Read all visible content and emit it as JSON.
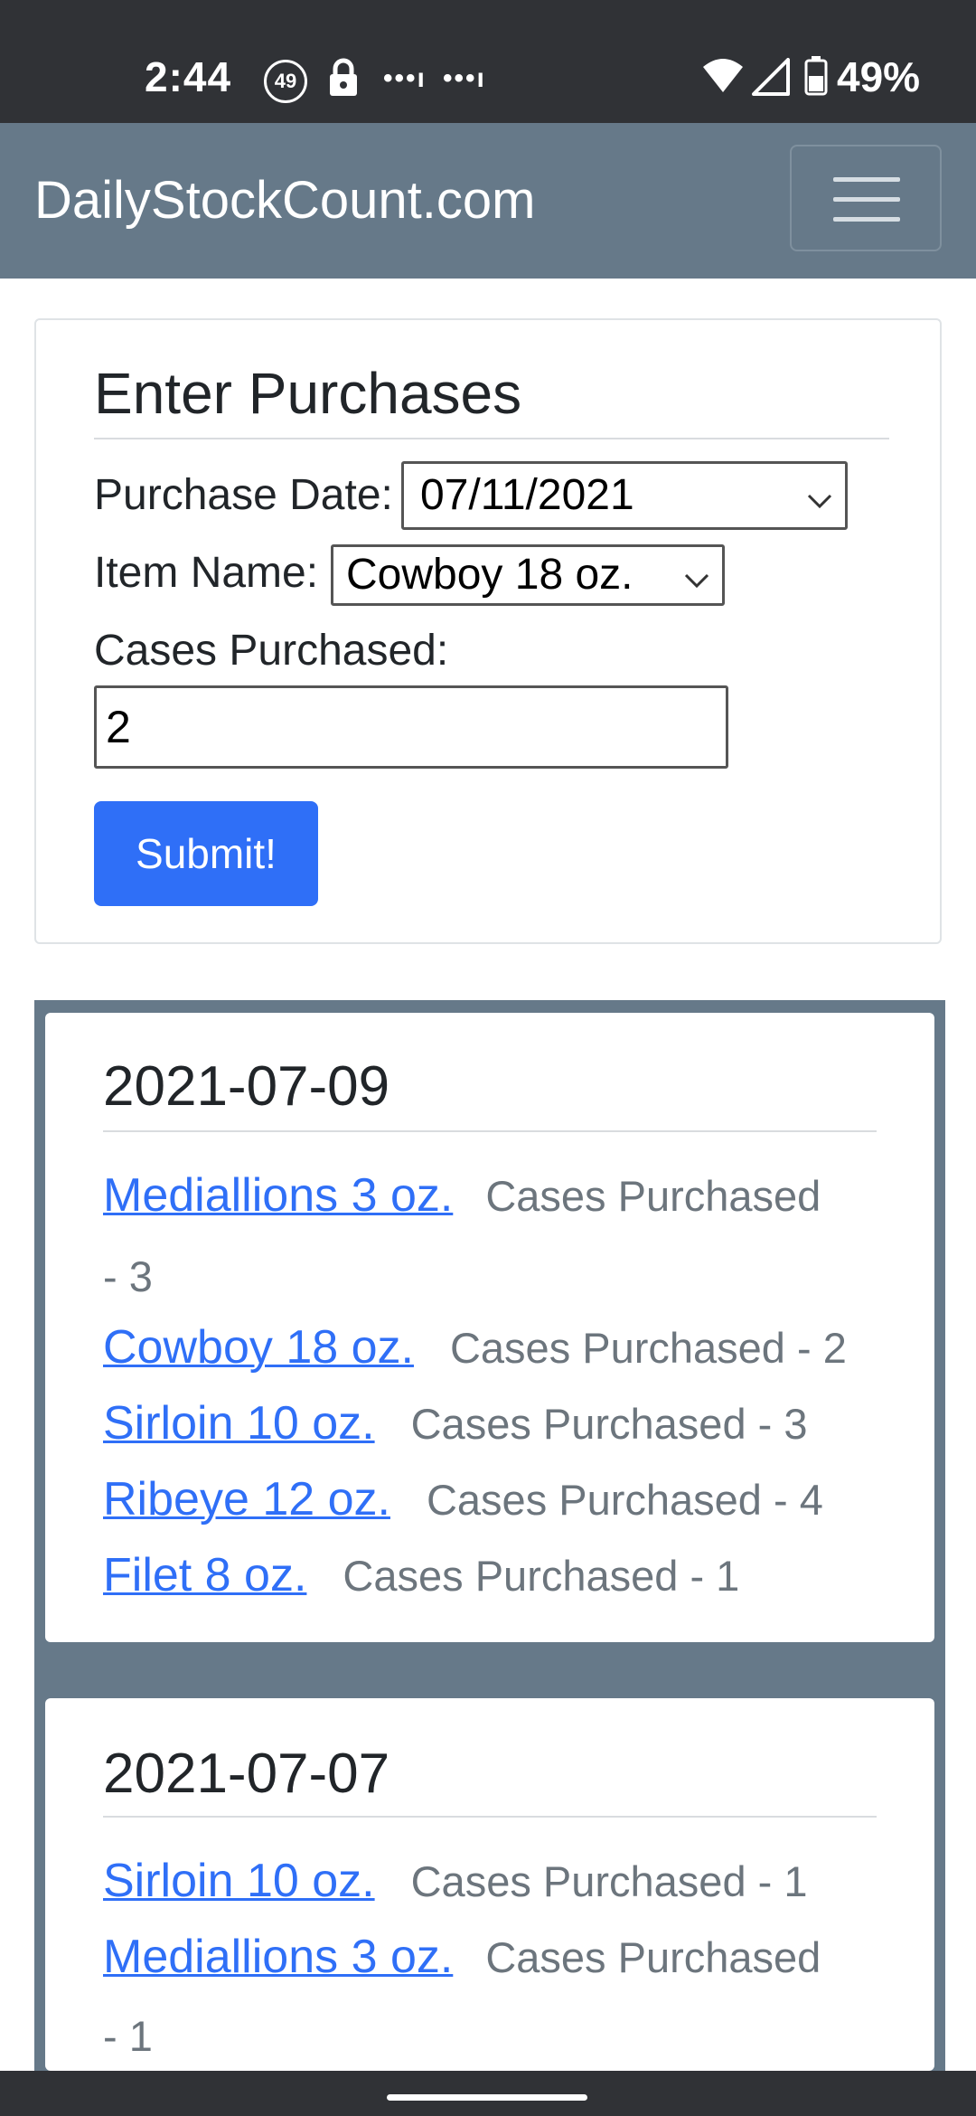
{
  "status_bar": {
    "time": "2:44",
    "notif_badge": "49",
    "dots1": "•••ı",
    "dots2": "•••ı",
    "battery": "49%"
  },
  "navbar": {
    "brand": "DailyStockCount.com",
    "menu_icon": "hamburger-icon"
  },
  "form": {
    "title": "Enter Purchases",
    "date_label": "Purchase Date:",
    "date_value": "07/11/2021",
    "item_label": "Item Name:",
    "item_value": "Cowboy 18 oz.",
    "cases_label": "Cases Purchased:",
    "cases_value": "2",
    "submit_label": "Submit!"
  },
  "history": [
    {
      "date": "2021-07-09",
      "entries": [
        {
          "item": "Mediallions 3 oz.",
          "cases": "Cases Purchased",
          "cases_cont": "- 3"
        },
        {
          "item": "Cowboy 18 oz.",
          "cases": "Cases Purchased - 2"
        },
        {
          "item": "Sirloin 10 oz.",
          "cases": "Cases Purchased - 3"
        },
        {
          "item": "Ribeye 12 oz.",
          "cases": "Cases Purchased - 4"
        },
        {
          "item": "Filet 8 oz.",
          "cases": "Cases Purchased - 1"
        }
      ]
    },
    {
      "date": "2021-07-07",
      "entries": [
        {
          "item": "Sirloin 10 oz.",
          "cases": "Cases Purchased - 1"
        },
        {
          "item": "Mediallions 3 oz.",
          "cases": "Cases Purchased",
          "cases_cont": "- 1"
        }
      ]
    }
  ],
  "colors": {
    "navbar": "#667989",
    "primary": "#2f6ff7",
    "status_bar": "#303236",
    "muted": "#6c757d"
  }
}
